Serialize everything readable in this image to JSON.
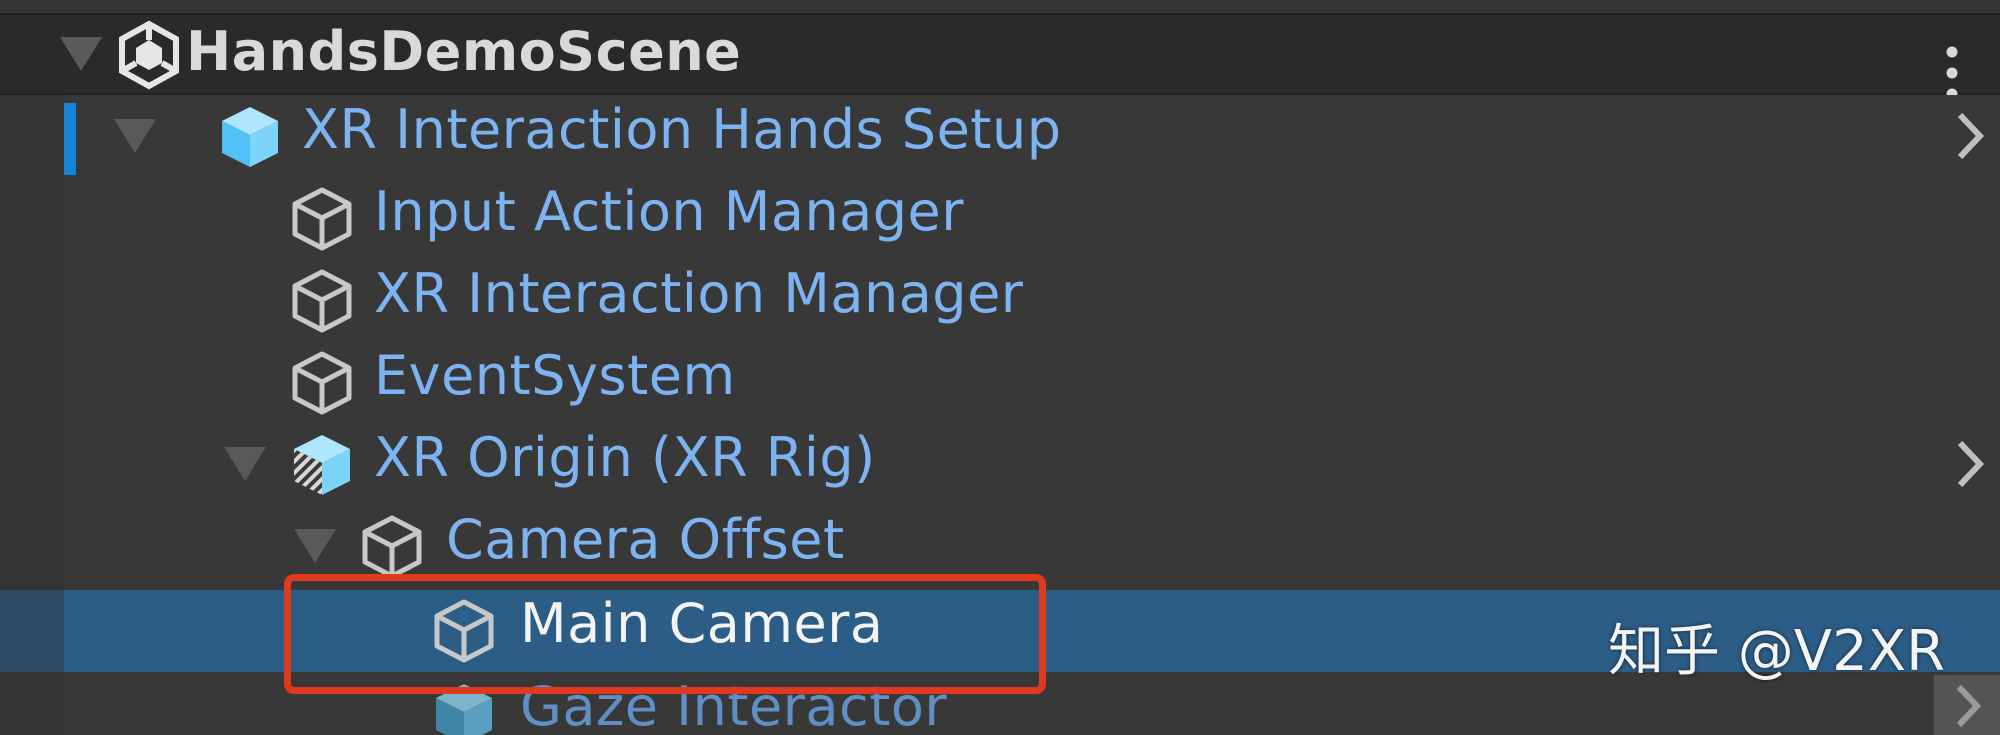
{
  "scene": {
    "name": "HandsDemoScene"
  },
  "hierarchy": {
    "items": [
      {
        "label": "XR Interaction Hands Setup",
        "icon": "prefab-cube-icon"
      },
      {
        "label": "Input Action Manager",
        "icon": "gameobject-cube-icon"
      },
      {
        "label": "XR Interaction Manager",
        "icon": "gameobject-cube-icon"
      },
      {
        "label": "EventSystem",
        "icon": "gameobject-cube-icon"
      },
      {
        "label": "XR Origin (XR Rig)",
        "icon": "prefab-variant-cube-icon"
      },
      {
        "label": "Camera Offset",
        "icon": "gameobject-cube-icon"
      },
      {
        "label": "Main Camera",
        "icon": "gameobject-cube-icon",
        "selected": true
      },
      {
        "label": "Gaze Interactor",
        "icon": "prefab-cube-icon"
      }
    ]
  },
  "watermark": {
    "text": "知乎 @V2XR"
  },
  "colors": {
    "background": "#383838",
    "header": "#2a2a2a",
    "prefab_text": "#7eb3f2",
    "selected_row": "#2c5d87",
    "highlight_box": "#e03a1e",
    "selection_accent": "#1483d8"
  }
}
